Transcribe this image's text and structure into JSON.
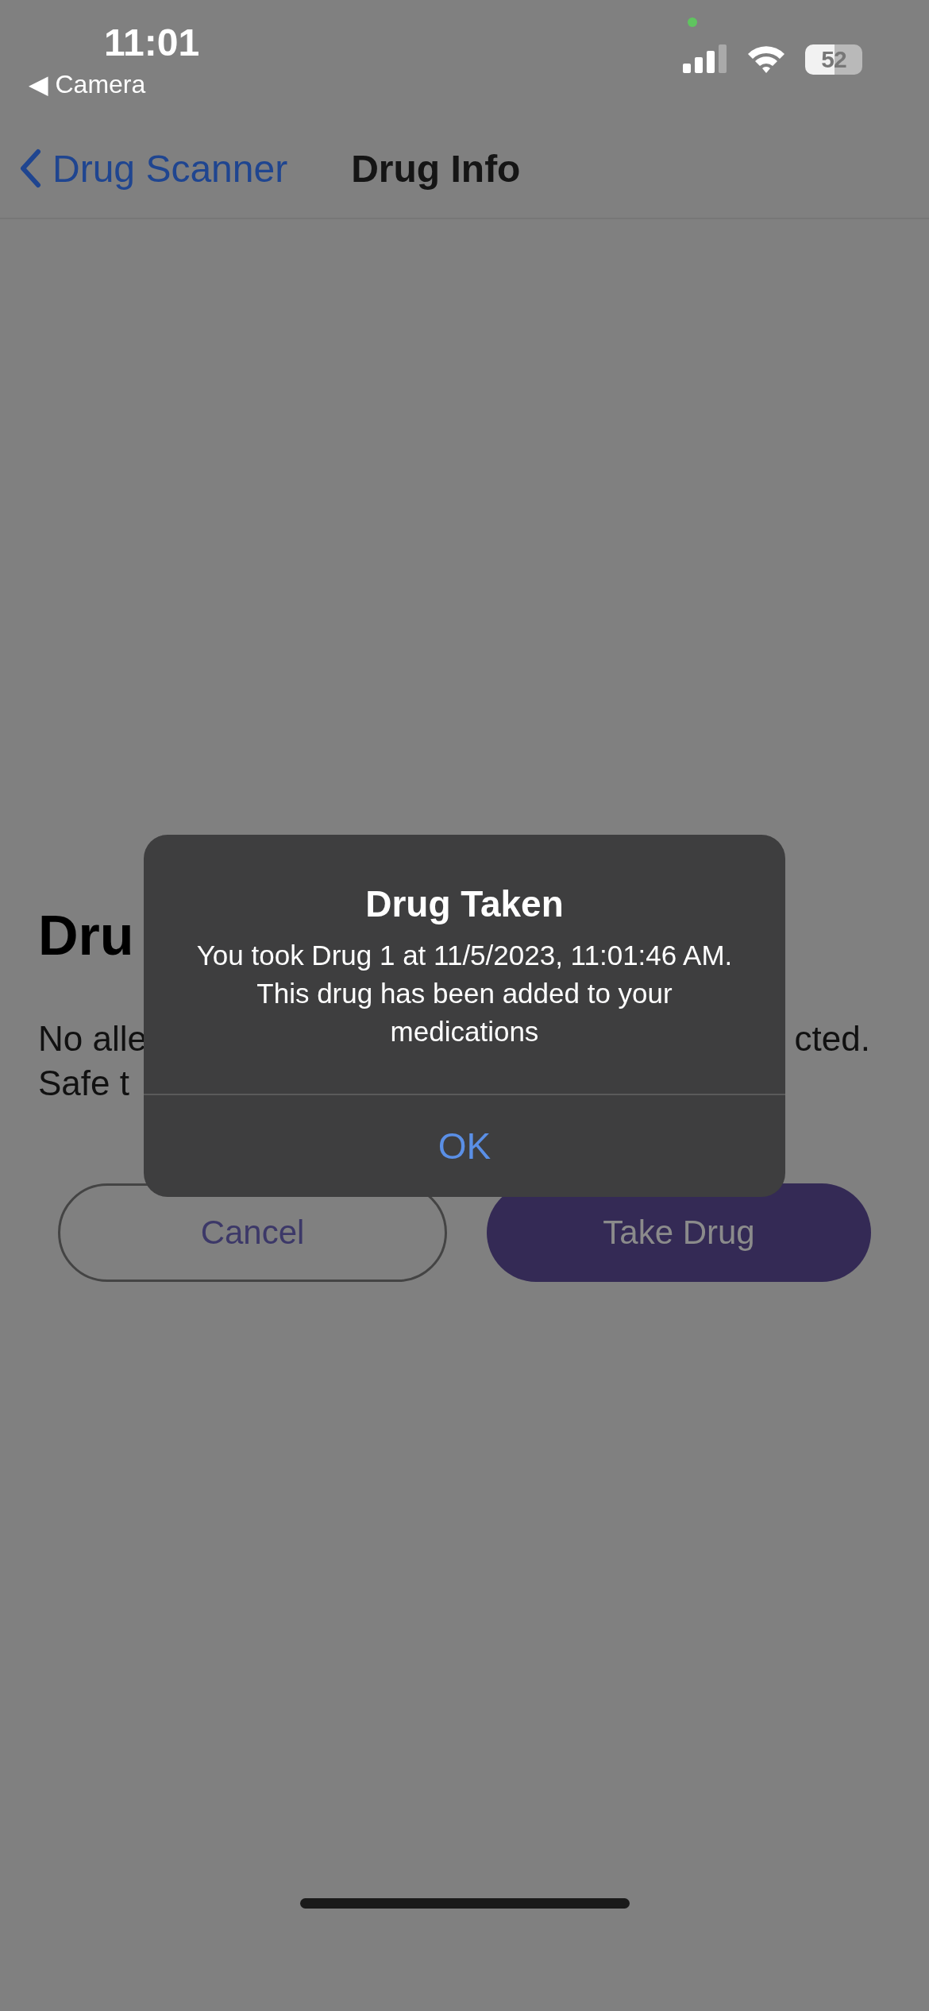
{
  "status_bar": {
    "time": "11:01",
    "back_app": "◀ Camera",
    "battery": "52",
    "mic_in_use": true
  },
  "nav": {
    "back_label": "Drug Scanner",
    "title": "Drug Info"
  },
  "content": {
    "heading": "Dru",
    "body_line_1_left": "No alle",
    "body_line_1_right": "cted.",
    "body_line_2": "Safe t",
    "buttons": [
      {
        "label": "Cancel",
        "kind": "outline"
      },
      {
        "label": "Take Drug",
        "kind": "filled"
      }
    ]
  },
  "alert": {
    "title": "Drug Taken",
    "message": "You took Drug 1 at 11/5/2023, 11:01:46 AM. This drug has been added to your medications",
    "button": "OK"
  }
}
